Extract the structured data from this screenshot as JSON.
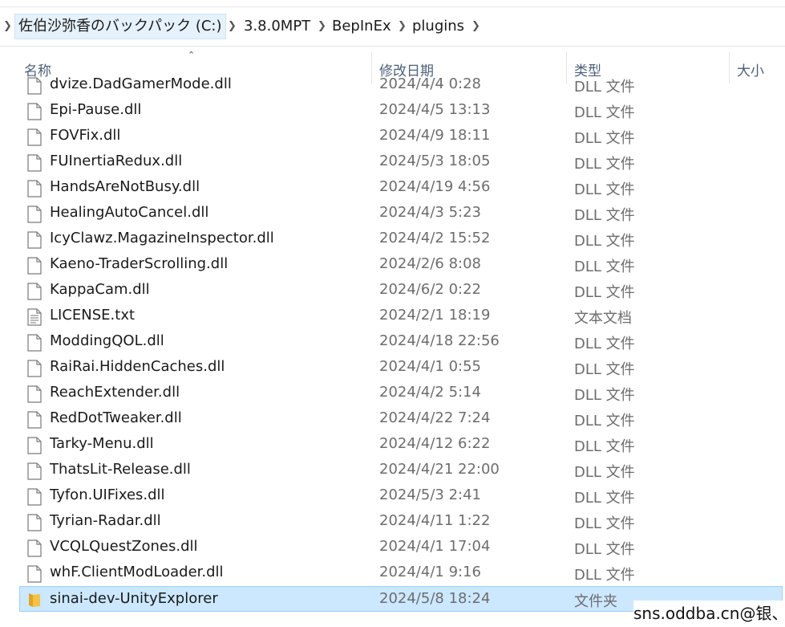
{
  "breadcrumb": {
    "items": [
      {
        "label": "佐伯沙弥香のバックパック (C:)"
      },
      {
        "label": "3.8.0MPT"
      },
      {
        "label": "BepInEx"
      },
      {
        "label": "plugins"
      }
    ]
  },
  "columns": {
    "name": "名称",
    "date": "修改日期",
    "type": "类型",
    "size": "大小"
  },
  "files": [
    {
      "name": "dvize.DadGamerMode.dll",
      "date": "2024/4/4 0:28",
      "type": "DLL 文件",
      "icon": "document-icon"
    },
    {
      "name": "Epi-Pause.dll",
      "date": "2024/4/5 13:13",
      "type": "DLL 文件",
      "icon": "document-icon"
    },
    {
      "name": "FOVFix.dll",
      "date": "2024/4/9 18:11",
      "type": "DLL 文件",
      "icon": "document-icon"
    },
    {
      "name": "FUInertiaRedux.dll",
      "date": "2024/5/3 18:05",
      "type": "DLL 文件",
      "icon": "document-icon"
    },
    {
      "name": "HandsAreNotBusy.dll",
      "date": "2024/4/19 4:56",
      "type": "DLL 文件",
      "icon": "document-icon"
    },
    {
      "name": "HealingAutoCancel.dll",
      "date": "2024/4/3 5:23",
      "type": "DLL 文件",
      "icon": "document-icon"
    },
    {
      "name": "IcyClawz.MagazineInspector.dll",
      "date": "2024/4/2 15:52",
      "type": "DLL 文件",
      "icon": "document-icon"
    },
    {
      "name": "Kaeno-TraderScrolling.dll",
      "date": "2024/2/6 8:08",
      "type": "DLL 文件",
      "icon": "document-icon"
    },
    {
      "name": "KappaCam.dll",
      "date": "2024/6/2 0:22",
      "type": "DLL 文件",
      "icon": "document-icon"
    },
    {
      "name": "LICENSE.txt",
      "date": "2024/2/1 18:19",
      "type": "文本文档",
      "icon": "text-document-icon"
    },
    {
      "name": "ModdingQOL.dll",
      "date": "2024/4/18 22:56",
      "type": "DLL 文件",
      "icon": "document-icon"
    },
    {
      "name": "RaiRai.HiddenCaches.dll",
      "date": "2024/4/1 0:55",
      "type": "DLL 文件",
      "icon": "document-icon"
    },
    {
      "name": "ReachExtender.dll",
      "date": "2024/4/2 5:14",
      "type": "DLL 文件",
      "icon": "document-icon"
    },
    {
      "name": "RedDotTweaker.dll",
      "date": "2024/4/22 7:24",
      "type": "DLL 文件",
      "icon": "document-icon"
    },
    {
      "name": "Tarky-Menu.dll",
      "date": "2024/4/12 6:22",
      "type": "DLL 文件",
      "icon": "document-icon"
    },
    {
      "name": "ThatsLit-Release.dll",
      "date": "2024/4/21 22:00",
      "type": "DLL 文件",
      "icon": "document-icon"
    },
    {
      "name": "Tyfon.UIFixes.dll",
      "date": "2024/5/3 2:41",
      "type": "DLL 文件",
      "icon": "document-icon"
    },
    {
      "name": "Tyrian-Radar.dll",
      "date": "2024/4/11 1:22",
      "type": "DLL 文件",
      "icon": "document-icon"
    },
    {
      "name": "VCQLQuestZones.dll",
      "date": "2024/4/1 17:04",
      "type": "DLL 文件",
      "icon": "document-icon"
    },
    {
      "name": "whF.ClientModLoader.dll",
      "date": "2024/4/1 9:16",
      "type": "DLL 文件",
      "icon": "document-icon"
    },
    {
      "name": "sinai-dev-UnityExplorer",
      "date": "2024/5/8 18:24",
      "type": "文件夹",
      "icon": "folder-icon",
      "selected": true
    }
  ],
  "watermark": "sns.oddba.cn@银、",
  "colors": {
    "selection_bg": "#cce8ff",
    "selection_border": "#99d1ff",
    "header_text": "#4c607a",
    "folder": "#f5c242"
  }
}
